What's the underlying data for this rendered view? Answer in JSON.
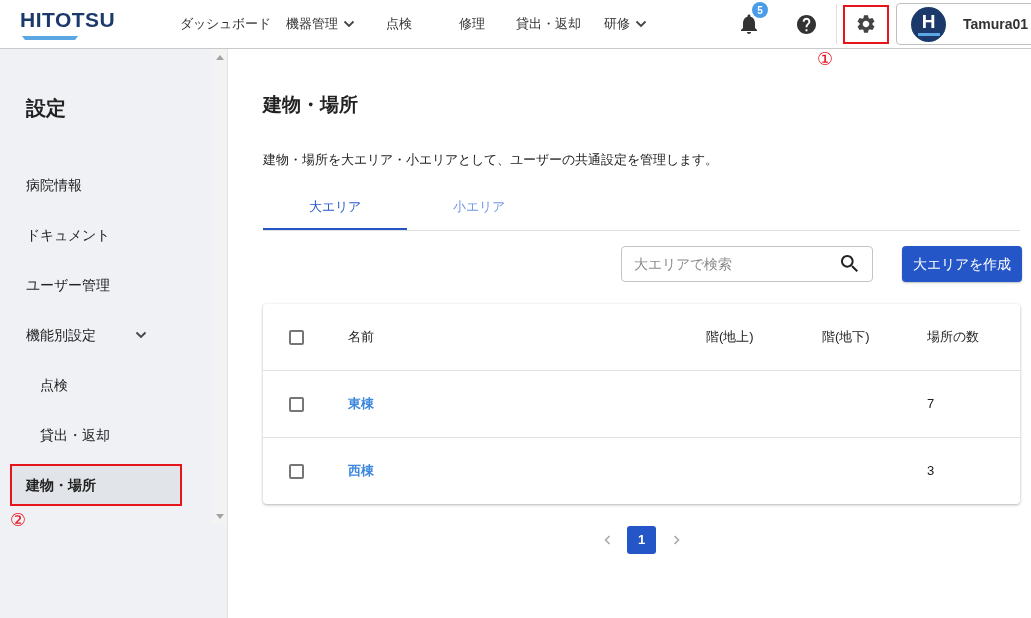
{
  "header": {
    "logo": "HITOTSU",
    "nav": [
      {
        "label": "ダッシュボード",
        "dropdown": false
      },
      {
        "label": "機器管理",
        "dropdown": true
      },
      {
        "label": "点検",
        "dropdown": false
      },
      {
        "label": "修理",
        "dropdown": false
      },
      {
        "label": "貸出・返却",
        "dropdown": false
      },
      {
        "label": "研修",
        "dropdown": true
      }
    ],
    "notification_badge": "5",
    "settings": {
      "callout": "①"
    },
    "user": {
      "avatar_letter": "H",
      "name": "Tamura01"
    }
  },
  "sidebar": {
    "title": "設定",
    "items": [
      {
        "label": "病院情報",
        "selected": false
      },
      {
        "label": "ドキュメント",
        "selected": false
      },
      {
        "label": "ユーザー管理",
        "selected": false
      },
      {
        "label": "機能別設定",
        "selected": false,
        "expanded": true,
        "children": [
          {
            "label": "点検",
            "selected": false
          },
          {
            "label": "貸出・返却",
            "selected": false
          }
        ]
      },
      {
        "label": "建物・場所",
        "selected": true,
        "callout": "②"
      }
    ]
  },
  "main": {
    "title": "建物・場所",
    "description": "建物・場所を大エリア・小エリアとして、ユーザーの共通設定を管理します。",
    "tabs": [
      {
        "label": "大エリア",
        "selected": true
      },
      {
        "label": "小エリア",
        "selected": false
      }
    ],
    "search": {
      "placeholder": "大エリアで検索"
    },
    "create_button": "大エリアを作成",
    "table": {
      "select_all_checked": false,
      "columns": [
        "名前",
        "階(地上)",
        "階(地下)",
        "場所の数"
      ],
      "rows": [
        {
          "checked": false,
          "name": "東棟",
          "place_count": "7"
        },
        {
          "checked": false,
          "name": "西棟",
          "place_count": "3"
        }
      ]
    },
    "pagination": {
      "pages": [
        {
          "label": "1",
          "selected": true
        }
      ]
    }
  }
}
